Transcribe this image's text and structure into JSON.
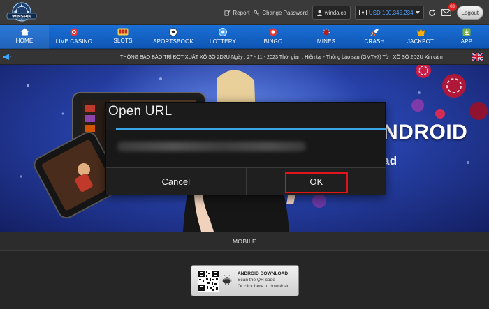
{
  "header": {
    "logo_text": "WINSPIN",
    "report_label": "Report",
    "change_password_label": "Change Password",
    "username": "windaica",
    "balance": "USD 100,345.234",
    "mail_count": "03",
    "logout_label": "Logout"
  },
  "nav": {
    "items": [
      {
        "label": "HOME",
        "icon": "home-icon"
      },
      {
        "label": "LIVE CASINO",
        "icon": "casino-chip-icon"
      },
      {
        "label": "SLOTS",
        "icon": "slot-machine-icon"
      },
      {
        "label": "SPORTSBOOK",
        "icon": "soccer-ball-icon"
      },
      {
        "label": "LOTTERY",
        "icon": "lottery-ball-icon"
      },
      {
        "label": "BINGO",
        "icon": "bingo-ball-icon"
      },
      {
        "label": "MINES",
        "icon": "mine-icon"
      },
      {
        "label": "CRASH",
        "icon": "rocket-icon"
      },
      {
        "label": "JACKPOT",
        "icon": "jackpot-icon"
      },
      {
        "label": "APP",
        "icon": "download-icon"
      }
    ]
  },
  "ticker": {
    "text": "THÔNG BÁO BẢO TRÌ ĐỘT XUẤT XỔ SỐ 2D2U Ngày : 27 - 11 - 2023 Thời gian : Hiện tại - Thông báo sau (GMT+7) Từ : XỔ SỐ 2D2U Xin cảm"
  },
  "banner": {
    "headline": "NDROID",
    "subline": "ad"
  },
  "dialog": {
    "title": "Open URL",
    "cancel_label": "Cancel",
    "ok_label": "OK"
  },
  "section": {
    "title": "MOBILE"
  },
  "download": {
    "title": "ANDROID DOWNLOAD",
    "line1": "Scan the QR code",
    "line2": "Or click here to download"
  },
  "colors": {
    "nav_blue": "#1565c8",
    "dialog_accent": "#3aa6e8",
    "highlight_red": "#e0141a",
    "badge_red": "#e02020",
    "balance_blue": "#4ea3ff"
  }
}
